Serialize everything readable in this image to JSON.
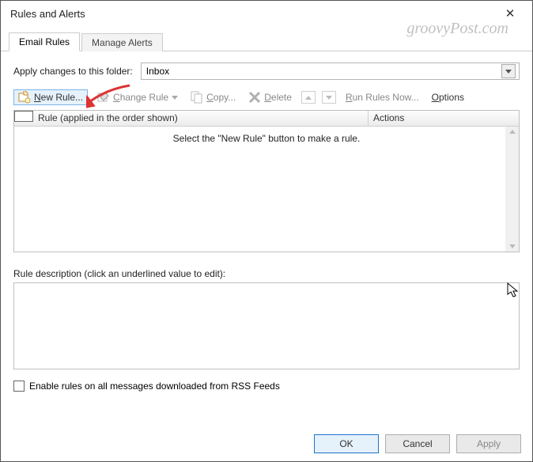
{
  "window": {
    "title": "Rules and Alerts"
  },
  "tabs": {
    "email_rules": "Email Rules",
    "manage_alerts": "Manage Alerts"
  },
  "folder": {
    "label": "Apply changes to this folder:",
    "value": "Inbox"
  },
  "toolbar": {
    "new_rule": "ew Rule...",
    "new_rule_mn": "N",
    "change_rule": "hange Rule",
    "change_rule_mn": "C",
    "copy": "opy...",
    "copy_mn": "C",
    "delete": "elete",
    "delete_mn": "D",
    "run_rules": "un Rules Now...",
    "run_rules_mn": "R",
    "options": "ptions",
    "options_mn": "O"
  },
  "columns": {
    "rule": "Rule (applied in the order shown)",
    "actions": "Actions"
  },
  "empty_msg": "Select the \"New Rule\" button to make a rule.",
  "desc_label": "Rule description (click an underlined value to edit):",
  "rss_checkbox": "Enable rules on all messages downloaded from RSS Feeds",
  "buttons": {
    "ok": "OK",
    "cancel": "Cancel",
    "apply": "Apply"
  },
  "watermark": "groovyPost.com"
}
